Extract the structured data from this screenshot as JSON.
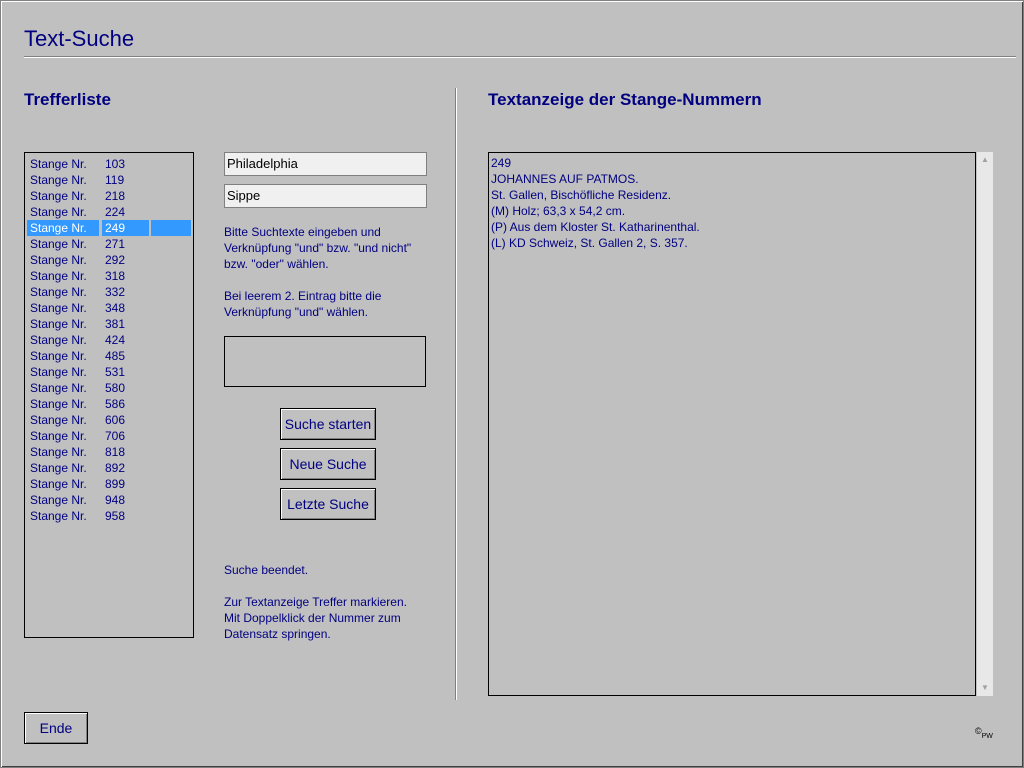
{
  "window": {
    "title": "Text-Suche"
  },
  "hits": {
    "heading": "Trefferliste",
    "selected_index": 4,
    "items": [
      {
        "label": "Stange Nr.",
        "number": "103"
      },
      {
        "label": "Stange Nr.",
        "number": "119"
      },
      {
        "label": "Stange Nr.",
        "number": "218"
      },
      {
        "label": "Stange Nr.",
        "number": "224"
      },
      {
        "label": "Stange Nr.",
        "number": "249"
      },
      {
        "label": "Stange Nr.",
        "number": "271"
      },
      {
        "label": "Stange Nr.",
        "number": "292"
      },
      {
        "label": "Stange Nr.",
        "number": "318"
      },
      {
        "label": "Stange Nr.",
        "number": "332"
      },
      {
        "label": "Stange Nr.",
        "number": "348"
      },
      {
        "label": "Stange Nr.",
        "number": "381"
      },
      {
        "label": "Stange Nr.",
        "number": "424"
      },
      {
        "label": "Stange Nr.",
        "number": "485"
      },
      {
        "label": "Stange Nr.",
        "number": "531"
      },
      {
        "label": "Stange Nr.",
        "number": "580"
      },
      {
        "label": "Stange Nr.",
        "number": "586"
      },
      {
        "label": "Stange Nr.",
        "number": "606"
      },
      {
        "label": "Stange Nr.",
        "number": "706"
      },
      {
        "label": "Stange Nr.",
        "number": "818"
      },
      {
        "label": "Stange Nr.",
        "number": "892"
      },
      {
        "label": "Stange Nr.",
        "number": "899"
      },
      {
        "label": "Stange Nr.",
        "number": "948"
      },
      {
        "label": "Stange Nr.",
        "number": "958"
      }
    ]
  },
  "search": {
    "field1_value": "Philadelphia",
    "field2_value": "Sippe",
    "help1": "Bitte Suchtexte eingeben und\nVerknüpfung \"und\" bzw. \"und nicht\"\nbzw. \"oder\" wählen.",
    "help2": "Bei leerem 2. Eintrag bitte die\nVerknüpfung \"und\" wählen.",
    "start_label": "Suche starten",
    "new_label": "Neue Suche",
    "last_label": "Letzte Suche",
    "status": "Suche beendet.",
    "hint": "Zur Textanzeige Treffer markieren.\nMit Doppelklick der Nummer zum\nDatensatz springen."
  },
  "display": {
    "heading": "Textanzeige der Stange-Nummern",
    "lines": [
      "249",
      "JOHANNES AUF PATMOS.",
      "St. Gallen, Bischöfliche Residenz.",
      "(M) Holz; 63,3 x 54,2 cm.",
      "(P) Aus dem Kloster St. Katharinenthal.",
      "(L) KD Schweiz, St. Gallen 2, S. 357."
    ]
  },
  "footer": {
    "end_label": "Ende",
    "copyright_symbol": "©",
    "copyright_initials": "PW"
  },
  "colors": {
    "background": "#c0c0c0",
    "text": "#000080",
    "selection": "#3399ff"
  }
}
